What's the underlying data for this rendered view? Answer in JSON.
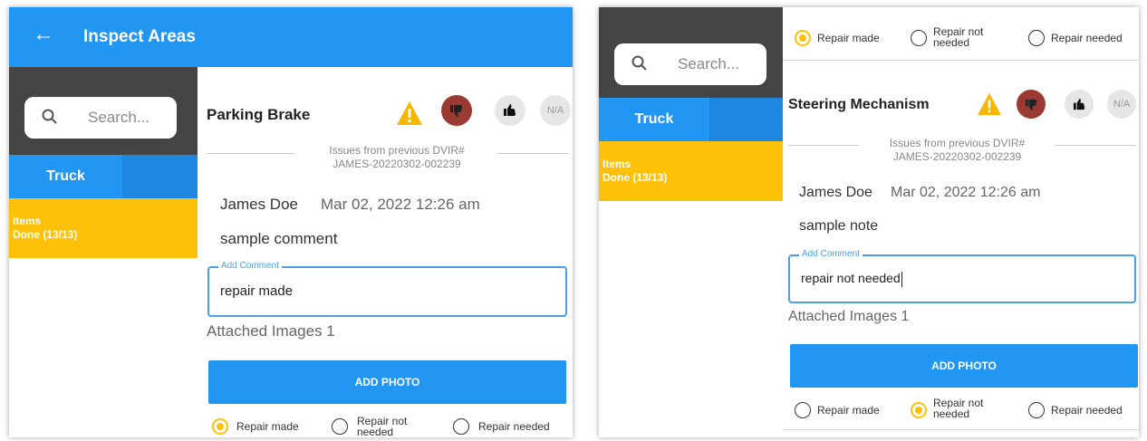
{
  "panel1": {
    "appbar": {
      "title": "Inspect Areas"
    },
    "search": {
      "placeholder": "Search..."
    },
    "tab": {
      "label": "Truck"
    },
    "items": {
      "label": "Items",
      "status": "Done (13/13)"
    },
    "item": {
      "title": "Parking Brake",
      "na_label": "N/A",
      "prev_line1": "Issues from previous DVIR#",
      "prev_line2": "JAMES-20220302-002239",
      "author": "James Doe",
      "date": "Mar 02, 2022 12:26 am",
      "comment": "sample comment",
      "field_label": "Add Comment",
      "field_value": "repair made",
      "attached": "Attached Images 1",
      "add_photo": "ADD PHOTO",
      "radio": {
        "made": "Repair made",
        "not_needed_1": "Repair not",
        "not_needed_2": "needed",
        "needed": "Repair needed",
        "selected": "Repair made"
      }
    }
  },
  "panel2": {
    "search": {
      "placeholder": "Search..."
    },
    "tab": {
      "label": "Truck"
    },
    "items": {
      "label": "Items",
      "status": "Done (13/13)"
    },
    "top_radio": {
      "made": "Repair made",
      "not_needed_1": "Repair not",
      "not_needed_2": "needed",
      "needed": "Repair needed",
      "selected": "Repair made"
    },
    "item": {
      "title": "Steering Mechanism",
      "na_label": "N/A",
      "prev_line1": "Issues from previous DVIR#",
      "prev_line2": "JAMES-20220302-002239",
      "author": "James Doe",
      "date": "Mar 02, 2022 12:26 am",
      "comment": "sample note",
      "field_label": "Add Comment",
      "field_value": "repair not needed",
      "attached": "Attached Images 1",
      "add_photo": "ADD PHOTO",
      "radio": {
        "made": "Repair made",
        "not_needed_1": "Repair not",
        "not_needed_2": "needed",
        "needed": "Repair needed",
        "selected": "Repair not needed"
      }
    }
  },
  "colors": {
    "primary": "#2196f3",
    "accent": "#ffc107",
    "thumbs_down": "#9a3a33",
    "sidebar_dark": "#444444"
  }
}
